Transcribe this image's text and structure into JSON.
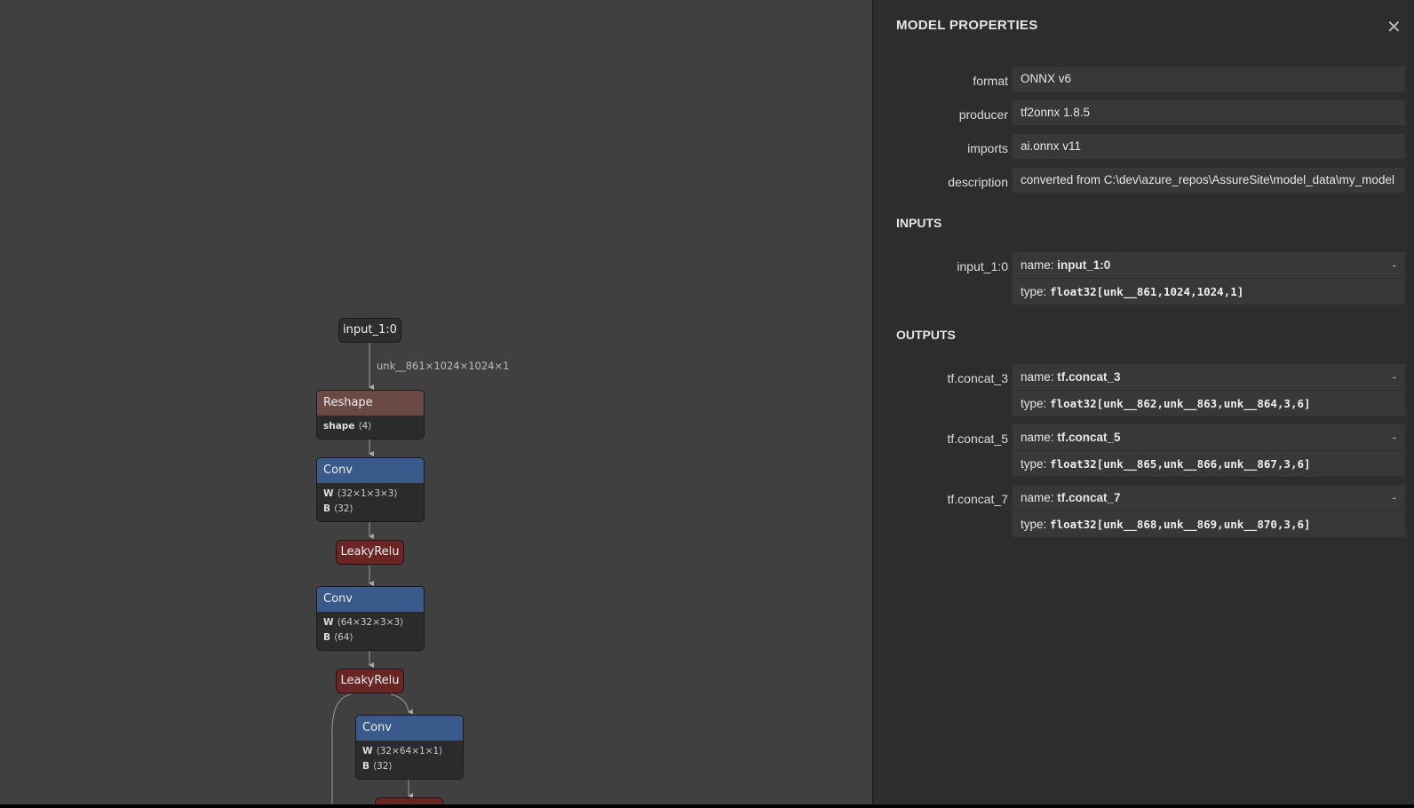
{
  "graph": {
    "input_node": "input_1:0",
    "edge_label": "unk__861×1024×1024×1",
    "nodes": [
      {
        "op": "Reshape",
        "attrs": [
          {
            "k": "shape",
            "v": "⟨4⟩"
          }
        ]
      },
      {
        "op": "Conv",
        "attrs": [
          {
            "k": "W",
            "v": "⟨32×1×3×3⟩"
          },
          {
            "k": "B",
            "v": "⟨32⟩"
          }
        ]
      },
      {
        "op": "LeakyRelu"
      },
      {
        "op": "Conv",
        "attrs": [
          {
            "k": "W",
            "v": "⟨64×32×3×3⟩"
          },
          {
            "k": "B",
            "v": "⟨64⟩"
          }
        ]
      },
      {
        "op": "LeakyRelu"
      },
      {
        "op": "Conv",
        "attrs": [
          {
            "k": "W",
            "v": "⟨32×64×1×1⟩"
          },
          {
            "k": "B",
            "v": "⟨32⟩"
          }
        ]
      }
    ]
  },
  "sidebar": {
    "title": "MODEL PROPERTIES",
    "close_icon": "✕",
    "properties": [
      {
        "label": "format",
        "value": "ONNX v6"
      },
      {
        "label": "producer",
        "value": "tf2onnx 1.8.5"
      },
      {
        "label": "imports",
        "value": "ai.onnx v11"
      },
      {
        "label": "description",
        "value": "converted from C:\\dev\\azure_repos\\AssureSite\\model_data\\my_model"
      }
    ],
    "inputs_title": "INPUTS",
    "inputs": [
      {
        "label": "input_1:0",
        "name_prefix": "name: ",
        "name": "input_1:0",
        "type_prefix": "type: ",
        "type": "float32[unk__861,1024,1024,1]",
        "toggle": "-"
      }
    ],
    "outputs_title": "OUTPUTS",
    "outputs": [
      {
        "label": "tf.concat_3",
        "name_prefix": "name: ",
        "name": "tf.concat_3",
        "type_prefix": "type: ",
        "type": "float32[unk__862,unk__863,unk__864,3,6]",
        "toggle": "-"
      },
      {
        "label": "tf.concat_5",
        "name_prefix": "name: ",
        "name": "tf.concat_5",
        "type_prefix": "type: ",
        "type": "float32[unk__865,unk__866,unk__867,3,6]",
        "toggle": "-"
      },
      {
        "label": "tf.concat_7",
        "name_prefix": "name: ",
        "name": "tf.concat_7",
        "type_prefix": "type: ",
        "type": "float32[unk__868,unk__869,unk__870,3,6]",
        "toggle": "-"
      }
    ]
  },
  "colors": {
    "canvas": "#404040",
    "sidebar": "#2d2d2d",
    "reshape": "#6b4a45",
    "conv": "#3a5a8c",
    "activation": "#6a2525"
  }
}
